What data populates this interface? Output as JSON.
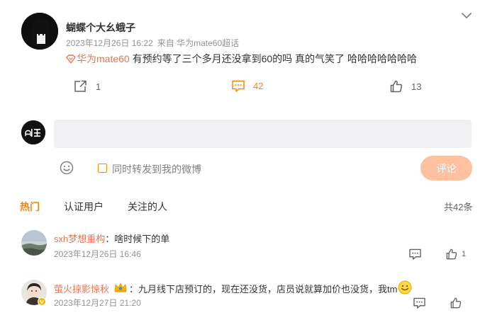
{
  "post": {
    "author": "蝴蝶个大幺蛾子",
    "date": "2023年12月26日 16:22",
    "source": "来自 华为mate60超话",
    "topic": "华为mate60",
    "text": " 有预约等了三个多月还没拿到60的吗 真的气笑了 哈哈哈哈哈哈哈",
    "repost_count": "1",
    "comment_count": "42",
    "like_count": "13"
  },
  "composer": {
    "placeholder": "",
    "repost_label": "同时转发到我的微博",
    "submit_label": "评论"
  },
  "tabs": [
    {
      "label": "热门"
    },
    {
      "label": "认证用户"
    },
    {
      "label": "关注的人"
    }
  ],
  "total_label": "共42条",
  "comments": [
    {
      "user": "sxh梦想重构",
      "separator": "：",
      "text": "啥时候下的单",
      "time": "2023年12月26日 16:46",
      "like_count": "1"
    },
    {
      "user": "萤火掠影惊秋",
      "separator": "：",
      "text": "九月线下店预订的，现在还没货，店员说就算加价也没货，我tm",
      "time": "2023年12月27日 21:20",
      "like_count": ""
    }
  ],
  "colors": {
    "accent": "#ff8200",
    "link": "#eb7350",
    "submit_disabled": "#ffc09f"
  }
}
